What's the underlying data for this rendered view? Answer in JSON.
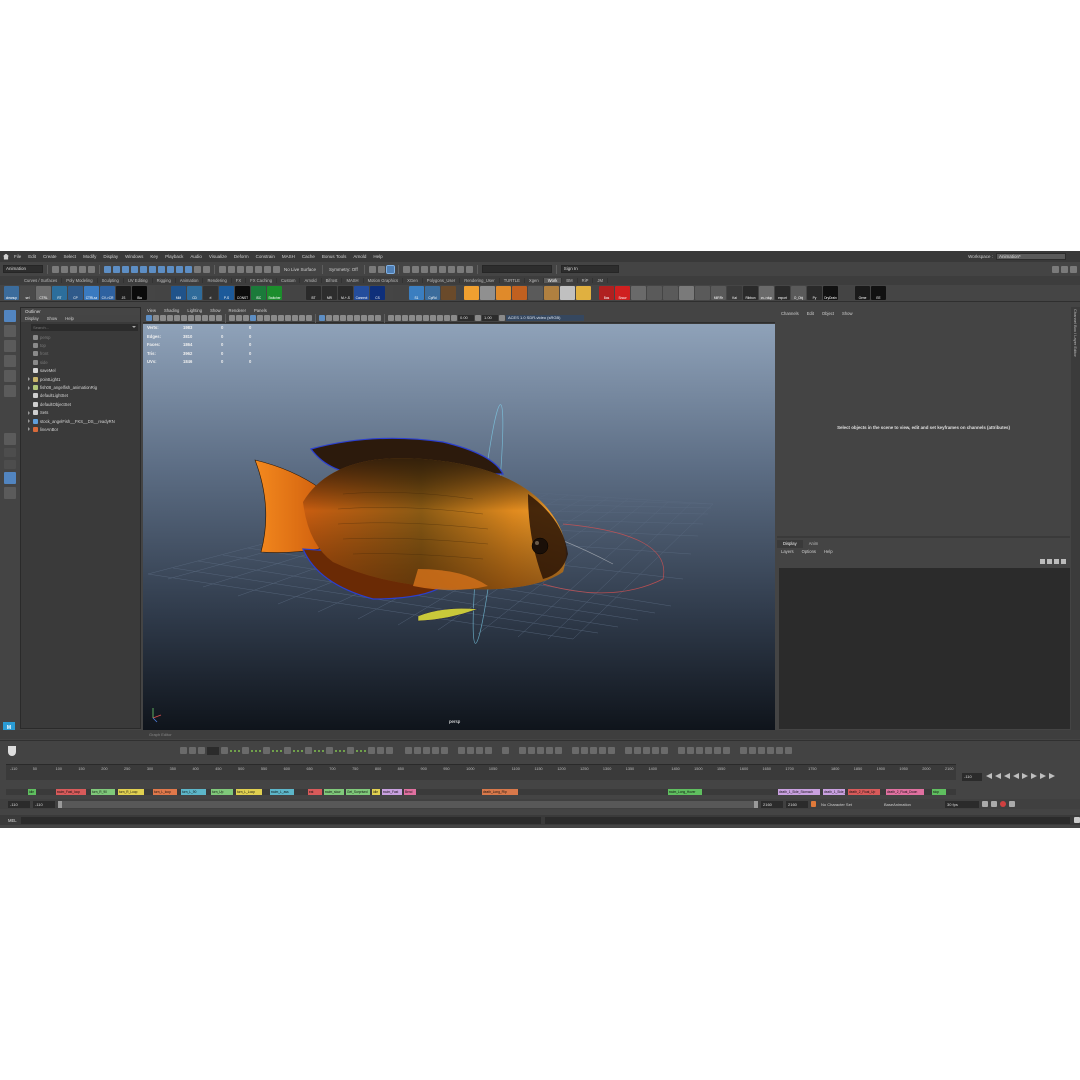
{
  "menubar": {
    "items": [
      "File",
      "Edit",
      "Create",
      "Select",
      "Modify",
      "Display",
      "Windows",
      "Key",
      "Playback",
      "Audio",
      "Visualize",
      "Deform",
      "Constrain",
      "MASH",
      "Cache",
      "Bonus Tools",
      "Arnold",
      "Help"
    ],
    "workspace_label": "Workspace :",
    "workspace_value": "Animation*"
  },
  "statusline": {
    "mode": "Animation",
    "no_live_surface": "No Live Surface",
    "symmetry": "Symmetry: Off",
    "sign_in": "Sign In"
  },
  "shelf_tabs": [
    "Curves / Surfaces",
    "Poly Modeling",
    "Sculpting",
    "UV Editing",
    "Rigging",
    "Animation",
    "Rendering",
    "FX",
    "FX Caching",
    "Custom",
    "Arnold",
    "Bifrost",
    "MASH",
    "Motion Graphics",
    "XGen",
    "Polygons_User",
    "Rendering_User",
    "TURTLE",
    "Xgen",
    "Work",
    "BM",
    "RiP",
    "JM"
  ],
  "shelf_buttons": [
    "cleanup",
    "sel",
    "CTRL",
    "RT",
    "CP",
    "CTRLsz",
    "CV->CR",
    "JS",
    "Bla",
    "",
    "MM",
    "CD",
    "rl",
    "P-S",
    "CONST",
    "ISC",
    "Switcher",
    "",
    "BT",
    "MR",
    "M-+-S",
    "Connect",
    "CS",
    "",
    "S1",
    "CpRd",
    "",
    "",
    "",
    "",
    "",
    "",
    "",
    "",
    "",
    "Bas",
    "Snow",
    "",
    "",
    "",
    "",
    "",
    "MIRRr",
    "Kai",
    "Ribbon",
    "cv->dup",
    "export",
    "O_Obj",
    "Py",
    "DryDrain",
    "",
    "Gene",
    "EE"
  ],
  "outliner": {
    "title": "Outliner",
    "menu": [
      "Display",
      "Show",
      "Help"
    ],
    "search_placeholder": "Search...",
    "items": [
      {
        "label": "persp",
        "dim": true,
        "color": "#8a8a8a"
      },
      {
        "label": "top",
        "dim": true,
        "color": "#8a8a8a"
      },
      {
        "label": "front",
        "dim": true,
        "color": "#8a8a8a"
      },
      {
        "label": "side",
        "dim": true,
        "color": "#8a8a8a"
      },
      {
        "label": "saveMel",
        "dim": false,
        "color": "#d8d8d8"
      },
      {
        "label": "pointLight1",
        "dim": false,
        "color": "#c9b66b"
      },
      {
        "label": "fish08_angelfish_animationRig",
        "dim": false,
        "color": "#b3c77a"
      },
      {
        "label": "defaultLightSet",
        "dim": false,
        "color": "#cfcfcf"
      },
      {
        "label": "defaultObjectSet",
        "dim": false,
        "color": "#cfcfcf"
      },
      {
        "label": "Sets",
        "dim": false,
        "color": "#cfcfcf"
      },
      {
        "label": "stock_angelFish__FKS__DS__readyRN",
        "dim": false,
        "color": "#5f9fdc"
      },
      {
        "label": "lineAnBor",
        "dim": false,
        "color": "#d86a3a"
      }
    ]
  },
  "viewport": {
    "menu": [
      "View",
      "Shading",
      "Lighting",
      "Show",
      "Renderer",
      "Panels"
    ],
    "exposure": "0.00",
    "gamma": "1.00",
    "color_space": "ACES 1.0 SDR-video (sRGB)",
    "camera": "persp",
    "hud": [
      {
        "label": "Verts:",
        "a": "1983",
        "b": "0",
        "c": "0"
      },
      {
        "label": "Edges:",
        "a": "3810",
        "b": "0",
        "c": "0"
      },
      {
        "label": "Faces:",
        "a": "1864",
        "b": "0",
        "c": "0"
      },
      {
        "label": "Tris:",
        "a": "3962",
        "b": "0",
        "c": "0"
      },
      {
        "label": "UVs:",
        "a": "1846",
        "b": "0",
        "c": "0"
      }
    ]
  },
  "channel_box": {
    "menu": [
      "Channels",
      "Edit",
      "Object",
      "Show"
    ],
    "message": "Select objects in the scene to view, edit and set keyframes on channels (attributes)"
  },
  "layer_editor": {
    "tabs": [
      "Display",
      "Anim"
    ],
    "menu": [
      "Layers",
      "Options",
      "Help"
    ]
  },
  "side_strip": "Channel Box / Layer Editor",
  "graph_editor_label": "Graph Editor",
  "timeline": {
    "ticks": [
      "-110",
      "50",
      "100",
      "150",
      "200",
      "250",
      "300",
      "350",
      "400",
      "450",
      "500",
      "550",
      "600",
      "650",
      "700",
      "750",
      "800",
      "850",
      "900",
      "950",
      "1000",
      "1050",
      "1100",
      "1150",
      "1200",
      "1250",
      "1300",
      "1350",
      "1400",
      "1450",
      "1500",
      "1550",
      "1600",
      "1650",
      "1700",
      "1750",
      "1800",
      "1850",
      "1900",
      "1950",
      "2000",
      "2100"
    ],
    "current_frame": "-110",
    "clips": [
      {
        "label": "idle",
        "color": "#5fbf5f"
      },
      {
        "label": "swim_Fast_loop",
        "color": "#d85a5a"
      },
      {
        "label": "turn_R_90",
        "color": "#7fc97a"
      },
      {
        "label": "turn_R_Loop",
        "color": "#e0d050"
      },
      {
        "label": "turn_L_loop",
        "color": "#e0784a"
      },
      {
        "label": "turn_L_90",
        "color": "#5cb6c9"
      },
      {
        "label": "turn_Up",
        "color": "#7fc97a"
      },
      {
        "label": "turn_L_Loop",
        "color": "#e0d050"
      },
      {
        "label": "swim_L_ass",
        "color": "#5cb6c9"
      },
      {
        "label": "eat",
        "color": "#d85a5a"
      },
      {
        "label": "swim_slow",
        "color": "#7fc97a"
      },
      {
        "label": "Get_Surprised",
        "color": "#7fc97a"
      },
      {
        "label": "idle",
        "color": "#e0d050"
      },
      {
        "label": "swim_Fast",
        "color": "#c9a0e0"
      },
      {
        "label": "Bend",
        "color": "#e070a0"
      },
      {
        "label": "death_Long_Flip",
        "color": "#d8784a"
      },
      {
        "label": "swim_Long_Hover",
        "color": "#5fbf5f"
      },
      {
        "label": "death_1_Side_Stomach",
        "color": "#c9a0e0"
      },
      {
        "label": "death_1_Side_Cent",
        "color": "#c9a0e0"
      },
      {
        "label": "death_2_Float_Up",
        "color": "#d85a5a"
      },
      {
        "label": "death_2_Float_Down",
        "color": "#e070a0"
      },
      {
        "label": "stop",
        "color": "#5fbf5f"
      }
    ]
  },
  "range": {
    "start": "-110",
    "inner_start": "-110",
    "inner_end": "2160",
    "end": "2160",
    "character_set": "No Character Set",
    "anim_layer": "BaseAnimation",
    "fps": "30 fps"
  },
  "mel": {
    "label": "MEL"
  }
}
